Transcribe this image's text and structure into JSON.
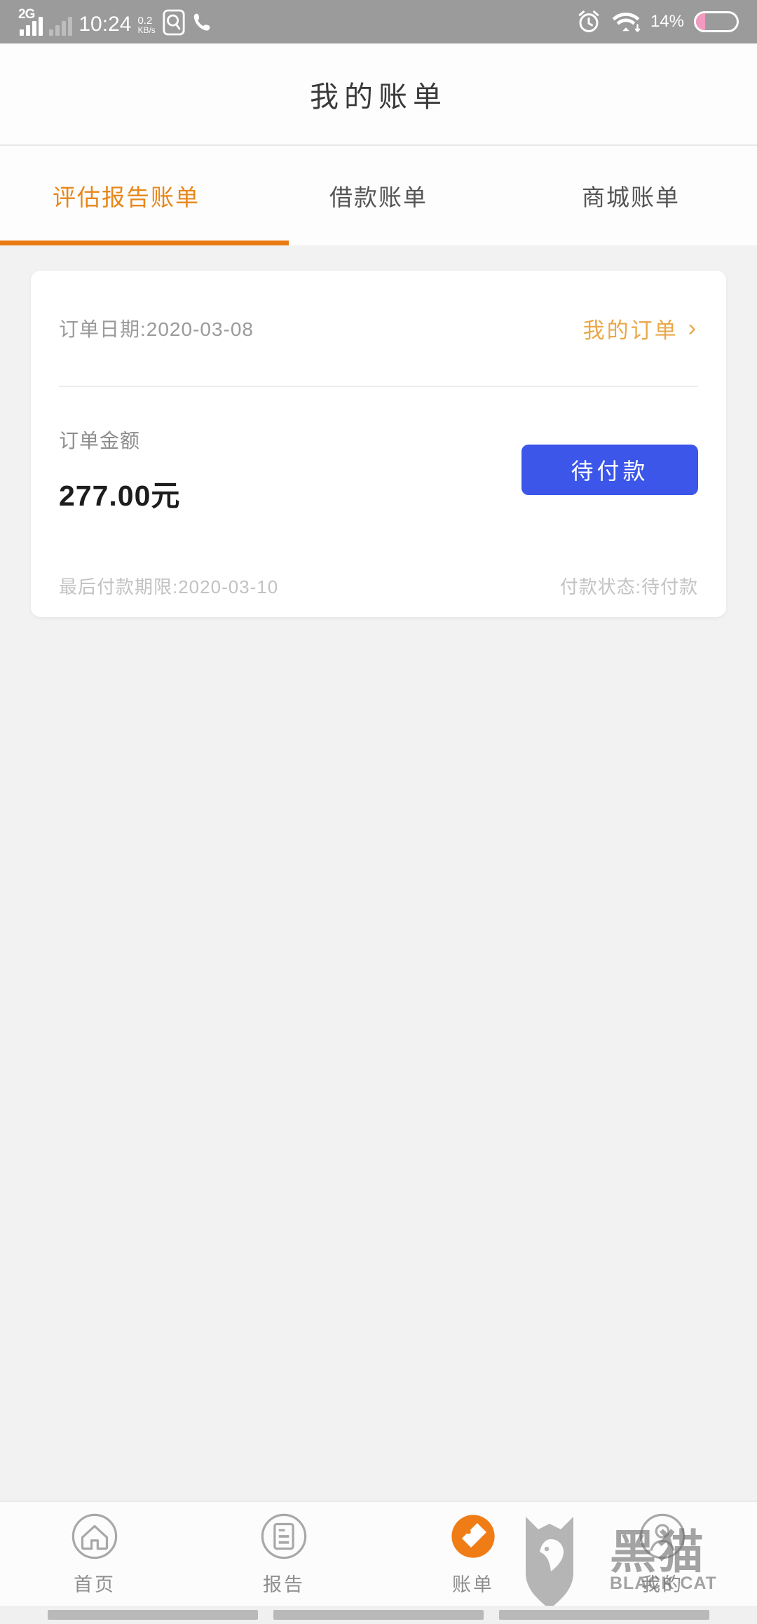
{
  "status_bar": {
    "network_type": "2G",
    "time": "10:24",
    "net_speed_value": "0.2",
    "net_speed_unit": "KB/s",
    "battery_percent": "14%",
    "icons": [
      "signal-bars-icon",
      "signal-bars-secondary-icon",
      "weibo-icon",
      "phone-icon",
      "alarm-clock-icon",
      "wifi-icon",
      "battery-icon"
    ],
    "bar_color": "#9b9b9b",
    "battery_fill_color": "#f49ac1"
  },
  "header": {
    "title": "我的账单"
  },
  "tabs": {
    "active_index": 0,
    "active_color": "#ea7b12",
    "items": [
      {
        "label": "评估报告账单"
      },
      {
        "label": "借款账单"
      },
      {
        "label": "商城账单"
      }
    ]
  },
  "order_card": {
    "order_date": "订单日期:2020-03-08",
    "my_order_link": "我的订单",
    "chevron": "›",
    "amount_label": "订单金额",
    "amount_value": "277.00元",
    "pay_button_label": "待付款",
    "pay_button_color": "#3b56e8",
    "deadline": "最后付款期限:2020-03-10",
    "payment_status": "付款状态:待付款"
  },
  "bottom_nav": {
    "active_index": 2,
    "active_color": "#f07c16",
    "items": [
      {
        "label": "首页",
        "icon": "home-icon"
      },
      {
        "label": "报告",
        "icon": "document-icon"
      },
      {
        "label": "账单",
        "icon": "price-tag-icon"
      },
      {
        "label": "我的",
        "icon": "user-icon"
      }
    ]
  },
  "watermark": {
    "cn": "黑猫",
    "en": "BLACK CAT"
  }
}
